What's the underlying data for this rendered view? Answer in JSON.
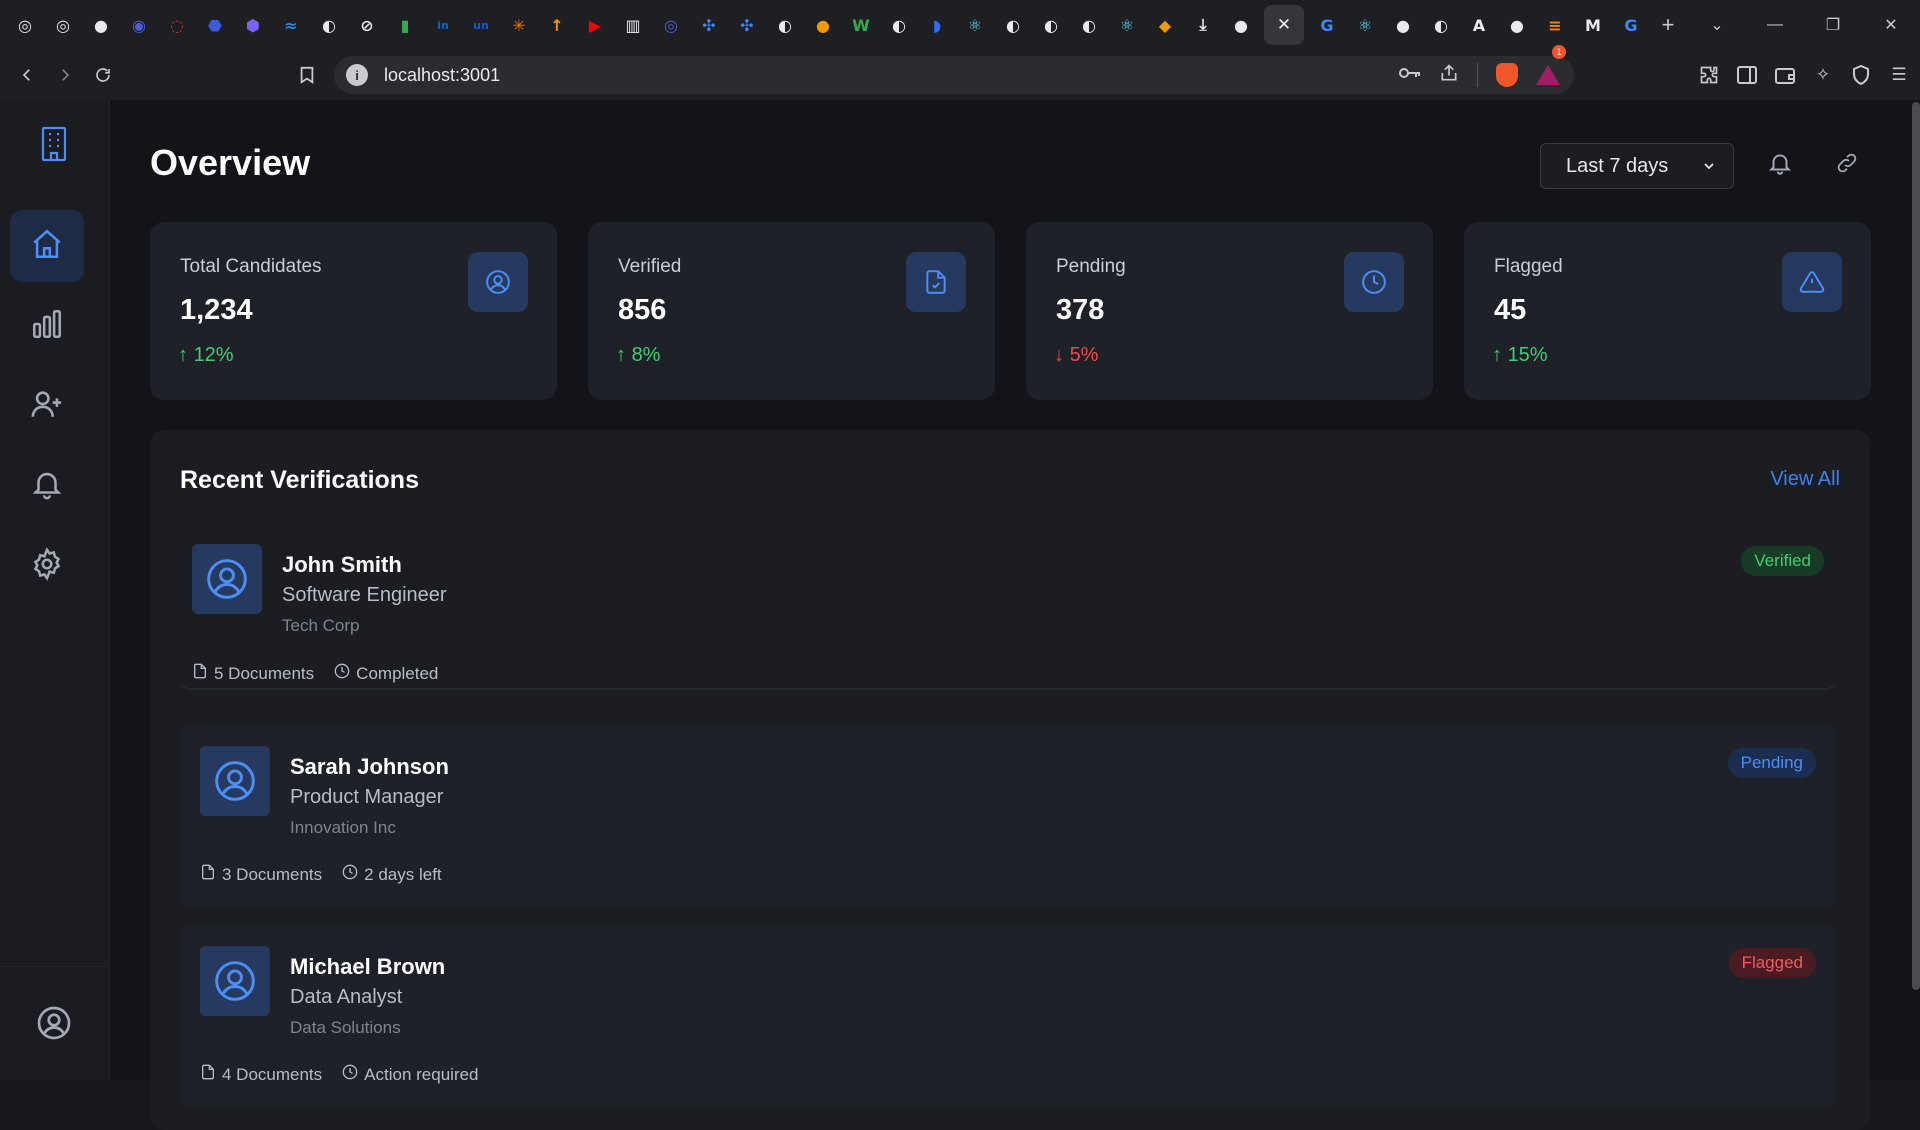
{
  "browser": {
    "url": "localhost:3001",
    "shield_count": "1",
    "tab_favicons": [
      {
        "name": "favicon-1",
        "color": "#e8eaed",
        "glyph": "◎"
      },
      {
        "name": "favicon-2",
        "color": "#e8eaed",
        "glyph": "◎"
      },
      {
        "name": "favicon-github",
        "color": "#e8eaed",
        "glyph": "●"
      },
      {
        "name": "favicon-4",
        "color": "#4f5bd5",
        "glyph": "◉"
      },
      {
        "name": "favicon-5",
        "color": "#d93025",
        "glyph": "◌"
      },
      {
        "name": "favicon-6",
        "color": "#3b5bdb",
        "glyph": "⬣"
      },
      {
        "name": "favicon-7",
        "color": "#7b61ff",
        "glyph": "⬢"
      },
      {
        "name": "favicon-8",
        "color": "#2f80ed",
        "glyph": "≈"
      },
      {
        "name": "favicon-9",
        "color": "#e8eaed",
        "glyph": "◐"
      },
      {
        "name": "favicon-10",
        "color": "#e8eaed",
        "glyph": "⊘"
      },
      {
        "name": "favicon-11",
        "color": "#34a853",
        "glyph": "▮"
      },
      {
        "name": "favicon-linkedin",
        "color": "#0a66c2",
        "glyph": "in"
      },
      {
        "name": "favicon-unstop",
        "color": "#1a56db",
        "glyph": "un"
      },
      {
        "name": "favicon-14",
        "color": "#e8710a",
        "glyph": "✳"
      },
      {
        "name": "favicon-15",
        "color": "#f29900",
        "glyph": "↑"
      },
      {
        "name": "favicon-youtube",
        "color": "#ff0000",
        "glyph": "▶"
      },
      {
        "name": "favicon-17",
        "color": "#e8eaed",
        "glyph": "▥"
      },
      {
        "name": "favicon-18",
        "color": "#4f5bd5",
        "glyph": "◎"
      },
      {
        "name": "favicon-19",
        "color": "#4285f4",
        "glyph": "✣"
      },
      {
        "name": "favicon-20",
        "color": "#4285f4",
        "glyph": "✣"
      },
      {
        "name": "favicon-21",
        "color": "#e8eaed",
        "glyph": "◐"
      },
      {
        "name": "favicon-22",
        "color": "#f29900",
        "glyph": "●"
      },
      {
        "name": "favicon-23",
        "color": "#34a853",
        "glyph": "W"
      },
      {
        "name": "favicon-24",
        "color": "#e8eaed",
        "glyph": "◐"
      },
      {
        "name": "favicon-25",
        "color": "#2f6bff",
        "glyph": "◗"
      },
      {
        "name": "favicon-26",
        "color": "#61dafb",
        "glyph": "⚛"
      },
      {
        "name": "favicon-27",
        "color": "#e8eaed",
        "glyph": "◐"
      },
      {
        "name": "favicon-28",
        "color": "#e8eaed",
        "glyph": "◐"
      },
      {
        "name": "favicon-29",
        "color": "#e8eaed",
        "glyph": "◐"
      },
      {
        "name": "favicon-30",
        "color": "#61dafb",
        "glyph": "⚛"
      },
      {
        "name": "favicon-31",
        "color": "#f29900",
        "glyph": "◆"
      },
      {
        "name": "favicon-download",
        "color": "#e8eaed",
        "glyph": "⤓"
      },
      {
        "name": "favicon-github-2",
        "color": "#e8eaed",
        "glyph": "●"
      }
    ],
    "tab_favicons_after": [
      {
        "name": "favicon-google",
        "color": "#4285f4",
        "glyph": "G"
      },
      {
        "name": "favicon-react",
        "color": "#61dafb",
        "glyph": "⚛"
      },
      {
        "name": "favicon-github-3",
        "color": "#e8eaed",
        "glyph": "●"
      },
      {
        "name": "favicon-37",
        "color": "#e8eaed",
        "glyph": "◐"
      },
      {
        "name": "favicon-38",
        "color": "#e8eaed",
        "glyph": "A"
      },
      {
        "name": "favicon-github-4",
        "color": "#e8eaed",
        "glyph": "●"
      },
      {
        "name": "favicon-40",
        "color": "#f48024",
        "glyph": "≡"
      },
      {
        "name": "favicon-medium",
        "color": "#e8eaed",
        "glyph": "M"
      },
      {
        "name": "favicon-google-2",
        "color": "#4285f4",
        "glyph": "G"
      }
    ]
  },
  "page": {
    "title": "Overview",
    "range_label": "Last 7 days"
  },
  "stats": [
    {
      "label": "Total Candidates",
      "value": "1,234",
      "arrow": "↑",
      "change": "12%",
      "direction": "up",
      "icon": "user-circle-icon"
    },
    {
      "label": "Verified",
      "value": "856",
      "arrow": "↑",
      "change": "8%",
      "direction": "up",
      "icon": "file-check-icon"
    },
    {
      "label": "Pending",
      "value": "378",
      "arrow": "↓",
      "change": "5%",
      "direction": "down",
      "icon": "clock-icon"
    },
    {
      "label": "Flagged",
      "value": "45",
      "arrow": "↑",
      "change": "15%",
      "direction": "up",
      "icon": "alert-triangle-icon"
    }
  ],
  "recent": {
    "title": "Recent Verifications",
    "view_all": "View All",
    "items": [
      {
        "name": "John Smith",
        "role": "Software Engineer",
        "company": "Tech Corp",
        "documents": "5 Documents",
        "status_text": "Completed",
        "badge": "Verified",
        "badge_type": "verified"
      },
      {
        "name": "Sarah Johnson",
        "role": "Product Manager",
        "company": "Innovation Inc",
        "documents": "3 Documents",
        "status_text": "2 days left",
        "badge": "Pending",
        "badge_type": "pending"
      },
      {
        "name": "Michael Brown",
        "role": "Data Analyst",
        "company": "Data Solutions",
        "documents": "4 Documents",
        "status_text": "Action required",
        "badge": "Flagged",
        "badge_type": "flagged"
      }
    ]
  },
  "colors": {
    "accent": "#3b82f6",
    "positive": "#3ecf73",
    "negative": "#ef4b4b"
  }
}
